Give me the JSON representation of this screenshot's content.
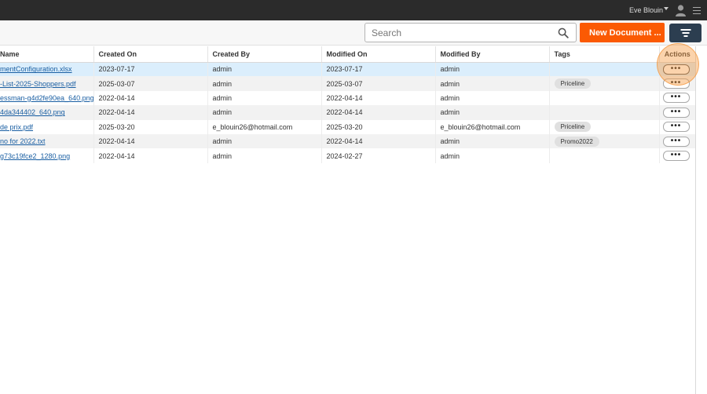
{
  "topbar": {
    "user_name": "Eve Blouin"
  },
  "toolbar": {
    "search_placeholder": "Search",
    "new_document_label": "New Document ..."
  },
  "table": {
    "columns": [
      "Name",
      "Created On",
      "Created By",
      "Modified On",
      "Modified By",
      "Tags",
      "Actions"
    ],
    "rows": [
      {
        "name": "mentConfiguration.xlsx",
        "created_on": "2023-07-17",
        "created_by": "admin",
        "modified_on": "2023-07-17",
        "modified_by": "admin",
        "tag": "",
        "action": "•••"
      },
      {
        "name": "-List-2025-Shoppers.pdf",
        "created_on": "2025-03-07",
        "created_by": "admin",
        "modified_on": "2025-03-07",
        "modified_by": "admin",
        "tag": "Priceline",
        "action": "•••"
      },
      {
        "name": "essman-g4d2fe90ea_640.png",
        "created_on": "2022-04-14",
        "created_by": "admin",
        "modified_on": "2022-04-14",
        "modified_by": "admin",
        "tag": "",
        "action": "•••"
      },
      {
        "name": "4da344402_640.png",
        "created_on": "2022-04-14",
        "created_by": "admin",
        "modified_on": "2022-04-14",
        "modified_by": "admin",
        "tag": "",
        "action": "•••"
      },
      {
        "name": "de prix.pdf",
        "created_on": "2025-03-20",
        "created_by": "e_blouin26@hotmail.com",
        "modified_on": "2025-03-20",
        "modified_by": "e_blouin26@hotmail.com",
        "tag": "Priceline",
        "action": "•••"
      },
      {
        "name": "no for 2022.txt",
        "created_on": "2022-04-14",
        "created_by": "admin",
        "modified_on": "2022-04-14",
        "modified_by": "admin",
        "tag": "Promo2022",
        "action": "•••"
      },
      {
        "name": "g73c19fce2_1280.png",
        "created_on": "2022-04-14",
        "created_by": "admin",
        "modified_on": "2024-02-27",
        "modified_by": "admin",
        "tag": "",
        "action": "•••"
      }
    ]
  }
}
